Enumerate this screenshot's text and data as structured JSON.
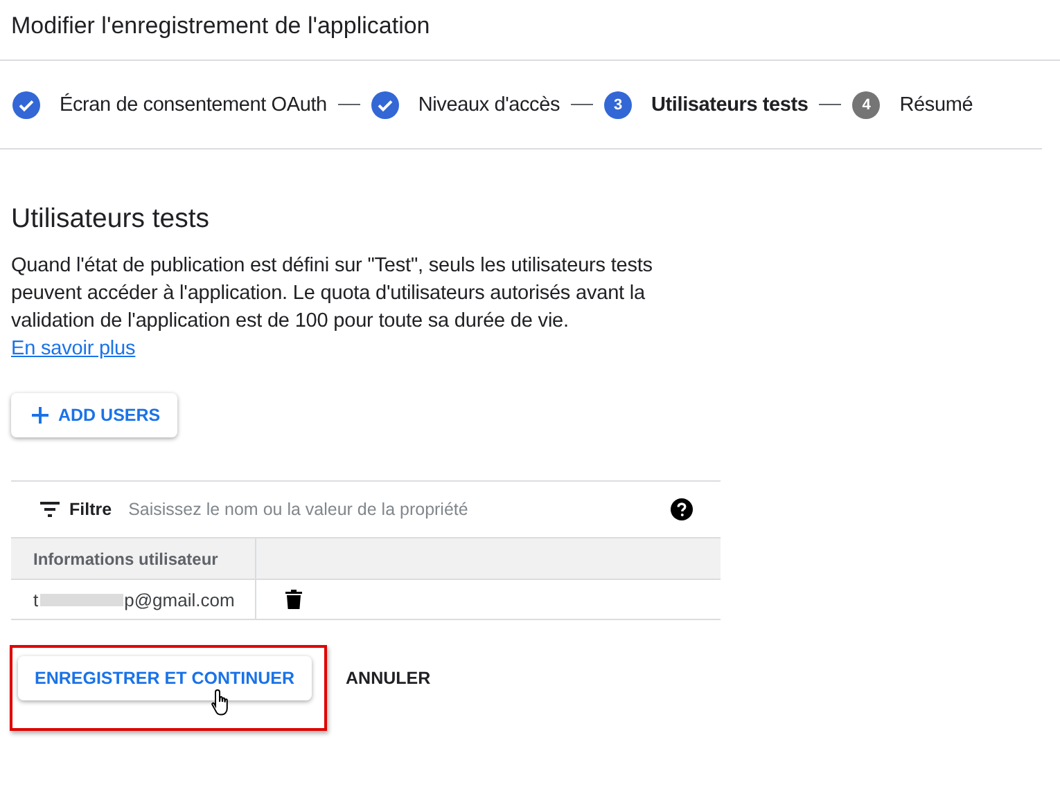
{
  "page_title": "Modifier l'enregistrement de l'application",
  "steps": [
    {
      "label": "Écran de consentement OAuth",
      "completed": true,
      "selected": false
    },
    {
      "label": "Niveaux d'accès",
      "completed": true,
      "selected": false
    },
    {
      "label": "Utilisateurs tests",
      "completed": false,
      "number": "3",
      "selected": true
    },
    {
      "label": "Résumé",
      "completed": false,
      "number": "4",
      "selected": false
    }
  ],
  "section": {
    "heading": "Utilisateurs tests",
    "description": "Quand l'état de publication est défini sur \"Test\", seuls les utilisateurs tests peuvent accéder à l'application. Le quota d'utilisateurs autorisés avant la validation de l'application est de 100 pour toute sa durée de vie.",
    "link": "En savoir plus"
  },
  "add_button": "ADD USERS",
  "filter": {
    "label": "Filtre",
    "placeholder": "Saisissez le nom ou la valeur de la propriété"
  },
  "table": {
    "columns": [
      "Informations utilisateur"
    ],
    "rows": [
      {
        "email_start": "t",
        "email_end": "p@gmail.com",
        "redacted": true
      }
    ]
  },
  "buttons": {
    "save": "ENREGISTRER ET CONTINUER",
    "cancel": "ANNULER",
    "save_highlighted": true
  }
}
